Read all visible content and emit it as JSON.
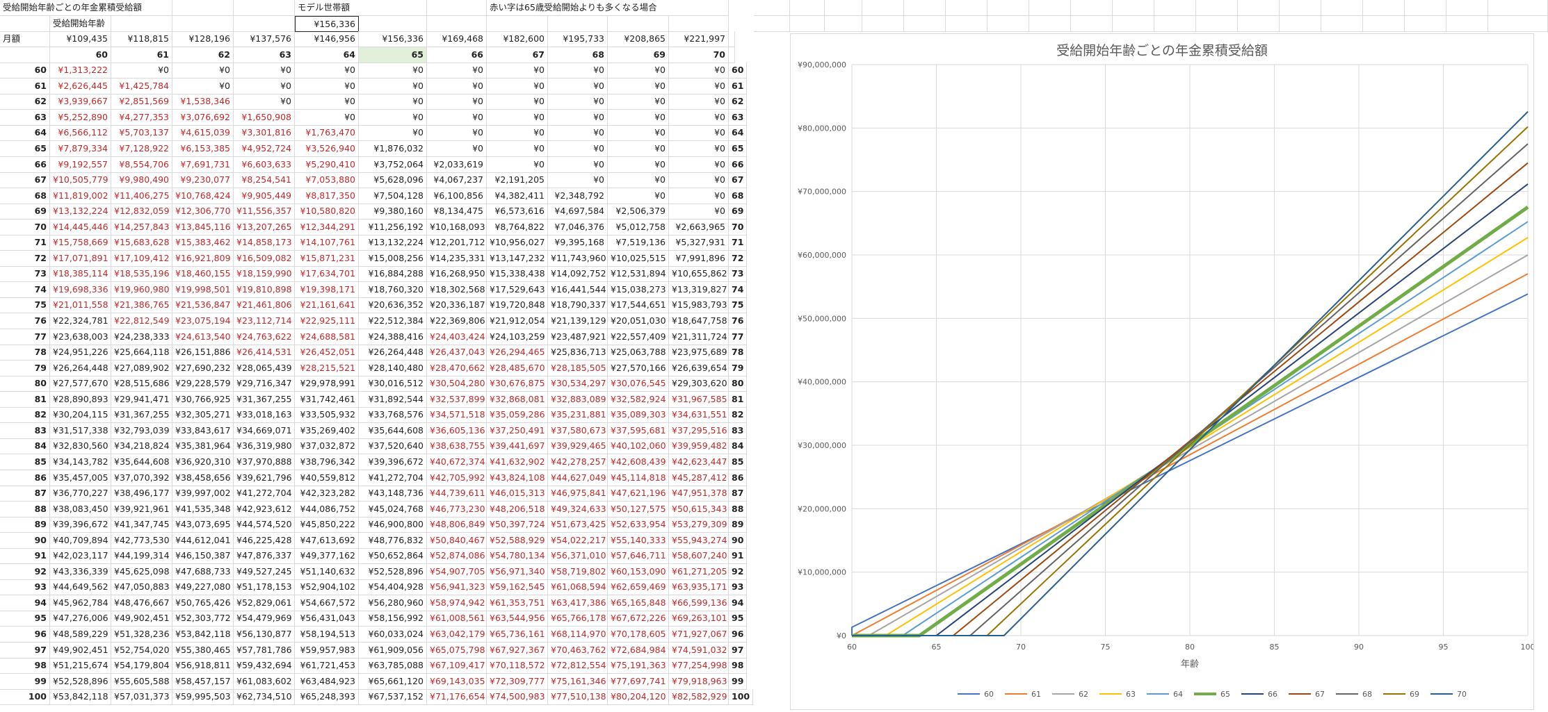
{
  "sheet": {
    "title": "受給開始年齢ごとの年金累積受給額",
    "model_label": "モデル世帯額",
    "red_note": "赤い字は65歳受給開始よりも多くなる場合",
    "start_label": "受給開始年齢",
    "model_value": "¥156,336",
    "monthly_label": "月額",
    "monthly": [
      "¥109,435",
      "¥118,815",
      "¥128,196",
      "¥137,576",
      "¥146,956",
      "¥156,336",
      "¥169,468",
      "¥182,600",
      "¥195,733",
      "¥208,865",
      "¥221,997"
    ],
    "start_ages": [
      "60",
      "61",
      "62",
      "63",
      "64",
      "65",
      "66",
      "67",
      "68",
      "69",
      "70"
    ],
    "rows": [
      {
        "age": "60",
        "cells": [
          "¥1,313,222",
          "¥0",
          "¥0",
          "¥0",
          "¥0",
          "¥0",
          "¥0",
          "¥0",
          "¥0",
          "¥0",
          "¥0"
        ]
      },
      {
        "age": "61",
        "cells": [
          "¥2,626,445",
          "¥1,425,784",
          "¥0",
          "¥0",
          "¥0",
          "¥0",
          "¥0",
          "¥0",
          "¥0",
          "¥0",
          "¥0"
        ]
      },
      {
        "age": "62",
        "cells": [
          "¥3,939,667",
          "¥2,851,569",
          "¥1,538,346",
          "¥0",
          "¥0",
          "¥0",
          "¥0",
          "¥0",
          "¥0",
          "¥0",
          "¥0"
        ]
      },
      {
        "age": "63",
        "cells": [
          "¥5,252,890",
          "¥4,277,353",
          "¥3,076,692",
          "¥1,650,908",
          "¥0",
          "¥0",
          "¥0",
          "¥0",
          "¥0",
          "¥0",
          "¥0"
        ]
      },
      {
        "age": "64",
        "cells": [
          "¥6,566,112",
          "¥5,703,137",
          "¥4,615,039",
          "¥3,301,816",
          "¥1,763,470",
          "¥0",
          "¥0",
          "¥0",
          "¥0",
          "¥0",
          "¥0"
        ]
      },
      {
        "age": "65",
        "cells": [
          "¥7,879,334",
          "¥7,128,922",
          "¥6,153,385",
          "¥4,952,724",
          "¥3,526,940",
          "¥1,876,032",
          "¥0",
          "¥0",
          "¥0",
          "¥0",
          "¥0"
        ]
      },
      {
        "age": "66",
        "cells": [
          "¥9,192,557",
          "¥8,554,706",
          "¥7,691,731",
          "¥6,603,633",
          "¥5,290,410",
          "¥3,752,064",
          "¥2,033,619",
          "¥0",
          "¥0",
          "¥0",
          "¥0"
        ]
      },
      {
        "age": "67",
        "cells": [
          "¥10,505,779",
          "¥9,980,490",
          "¥9,230,077",
          "¥8,254,541",
          "¥7,053,880",
          "¥5,628,096",
          "¥4,067,237",
          "¥2,191,205",
          "¥0",
          "¥0",
          "¥0"
        ]
      },
      {
        "age": "68",
        "cells": [
          "¥11,819,002",
          "¥11,406,275",
          "¥10,768,424",
          "¥9,905,449",
          "¥8,817,350",
          "¥7,504,128",
          "¥6,100,856",
          "¥4,382,411",
          "¥2,348,792",
          "¥0",
          "¥0"
        ]
      },
      {
        "age": "69",
        "cells": [
          "¥13,132,224",
          "¥12,832,059",
          "¥12,306,770",
          "¥11,556,357",
          "¥10,580,820",
          "¥9,380,160",
          "¥8,134,475",
          "¥6,573,616",
          "¥4,697,584",
          "¥2,506,379",
          "¥0"
        ]
      },
      {
        "age": "70",
        "cells": [
          "¥14,445,446",
          "¥14,257,843",
          "¥13,845,116",
          "¥13,207,265",
          "¥12,344,291",
          "¥11,256,192",
          "¥10,168,093",
          "¥8,764,822",
          "¥7,046,376",
          "¥5,012,758",
          "¥2,663,965"
        ]
      },
      {
        "age": "71",
        "cells": [
          "¥15,758,669",
          "¥15,683,628",
          "¥15,383,462",
          "¥14,858,173",
          "¥14,107,761",
          "¥13,132,224",
          "¥12,201,712",
          "¥10,956,027",
          "¥9,395,168",
          "¥7,519,136",
          "¥5,327,931"
        ]
      },
      {
        "age": "72",
        "cells": [
          "¥17,071,891",
          "¥17,109,412",
          "¥16,921,809",
          "¥16,509,082",
          "¥15,871,231",
          "¥15,008,256",
          "¥14,235,331",
          "¥13,147,232",
          "¥11,743,960",
          "¥10,025,515",
          "¥7,991,896"
        ]
      },
      {
        "age": "73",
        "cells": [
          "¥18,385,114",
          "¥18,535,196",
          "¥18,460,155",
          "¥18,159,990",
          "¥17,634,701",
          "¥16,884,288",
          "¥16,268,950",
          "¥15,338,438",
          "¥14,092,752",
          "¥12,531,894",
          "¥10,655,862"
        ]
      },
      {
        "age": "74",
        "cells": [
          "¥19,698,336",
          "¥19,960,980",
          "¥19,998,501",
          "¥19,810,898",
          "¥19,398,171",
          "¥18,760,320",
          "¥18,302,568",
          "¥17,529,643",
          "¥16,441,544",
          "¥15,038,273",
          "¥13,319,827"
        ]
      },
      {
        "age": "75",
        "cells": [
          "¥21,011,558",
          "¥21,386,765",
          "¥21,536,847",
          "¥21,461,806",
          "¥21,161,641",
          "¥20,636,352",
          "¥20,336,187",
          "¥19,720,848",
          "¥18,790,337",
          "¥17,544,651",
          "¥15,983,793"
        ]
      },
      {
        "age": "76",
        "cells": [
          "¥22,324,781",
          "¥22,812,549",
          "¥23,075,194",
          "¥23,112,714",
          "¥22,925,111",
          "¥22,512,384",
          "¥22,369,806",
          "¥21,912,054",
          "¥21,139,129",
          "¥20,051,030",
          "¥18,647,758"
        ]
      },
      {
        "age": "77",
        "cells": [
          "¥23,638,003",
          "¥24,238,333",
          "¥24,613,540",
          "¥24,763,622",
          "¥24,688,581",
          "¥24,388,416",
          "¥24,403,424",
          "¥24,103,259",
          "¥23,487,921",
          "¥22,557,409",
          "¥21,311,724"
        ]
      },
      {
        "age": "78",
        "cells": [
          "¥24,951,226",
          "¥25,664,118",
          "¥26,151,886",
          "¥26,414,531",
          "¥26,452,051",
          "¥26,264,448",
          "¥26,437,043",
          "¥26,294,465",
          "¥25,836,713",
          "¥25,063,788",
          "¥23,975,689"
        ]
      },
      {
        "age": "79",
        "cells": [
          "¥26,264,448",
          "¥27,089,902",
          "¥27,690,232",
          "¥28,065,439",
          "¥28,215,521",
          "¥28,140,480",
          "¥28,470,662",
          "¥28,485,670",
          "¥28,185,505",
          "¥27,570,166",
          "¥26,639,654"
        ]
      },
      {
        "age": "80",
        "cells": [
          "¥27,577,670",
          "¥28,515,686",
          "¥29,228,579",
          "¥29,716,347",
          "¥29,978,991",
          "¥30,016,512",
          "¥30,504,280",
          "¥30,676,875",
          "¥30,534,297",
          "¥30,076,545",
          "¥29,303,620"
        ]
      },
      {
        "age": "81",
        "cells": [
          "¥28,890,893",
          "¥29,941,471",
          "¥30,766,925",
          "¥31,367,255",
          "¥31,742,461",
          "¥31,892,544",
          "¥32,537,899",
          "¥32,868,081",
          "¥32,883,089",
          "¥32,582,924",
          "¥31,967,585"
        ]
      },
      {
        "age": "82",
        "cells": [
          "¥30,204,115",
          "¥31,367,255",
          "¥32,305,271",
          "¥33,018,163",
          "¥33,505,932",
          "¥33,768,576",
          "¥34,571,518",
          "¥35,059,286",
          "¥35,231,881",
          "¥35,089,303",
          "¥34,631,551"
        ]
      },
      {
        "age": "83",
        "cells": [
          "¥31,517,338",
          "¥32,793,039",
          "¥33,843,617",
          "¥34,669,071",
          "¥35,269,402",
          "¥35,644,608",
          "¥36,605,136",
          "¥37,250,491",
          "¥37,580,673",
          "¥37,595,681",
          "¥37,295,516"
        ]
      },
      {
        "age": "84",
        "cells": [
          "¥32,830,560",
          "¥34,218,824",
          "¥35,381,964",
          "¥36,319,980",
          "¥37,032,872",
          "¥37,520,640",
          "¥38,638,755",
          "¥39,441,697",
          "¥39,929,465",
          "¥40,102,060",
          "¥39,959,482"
        ]
      },
      {
        "age": "85",
        "cells": [
          "¥34,143,782",
          "¥35,644,608",
          "¥36,920,310",
          "¥37,970,888",
          "¥38,796,342",
          "¥39,396,672",
          "¥40,672,374",
          "¥41,632,902",
          "¥42,278,257",
          "¥42,608,439",
          "¥42,623,447"
        ]
      },
      {
        "age": "86",
        "cells": [
          "¥35,457,005",
          "¥37,070,392",
          "¥38,458,656",
          "¥39,621,796",
          "¥40,559,812",
          "¥41,272,704",
          "¥42,705,992",
          "¥43,824,108",
          "¥44,627,049",
          "¥45,114,818",
          "¥45,287,412"
        ]
      },
      {
        "age": "87",
        "cells": [
          "¥36,770,227",
          "¥38,496,177",
          "¥39,997,002",
          "¥41,272,704",
          "¥42,323,282",
          "¥43,148,736",
          "¥44,739,611",
          "¥46,015,313",
          "¥46,975,841",
          "¥47,621,196",
          "¥47,951,378"
        ]
      },
      {
        "age": "88",
        "cells": [
          "¥38,083,450",
          "¥39,921,961",
          "¥41,535,348",
          "¥42,923,612",
          "¥44,086,752",
          "¥45,024,768",
          "¥46,773,230",
          "¥48,206,518",
          "¥49,324,633",
          "¥50,127,575",
          "¥50,615,343"
        ]
      },
      {
        "age": "89",
        "cells": [
          "¥39,396,672",
          "¥41,347,745",
          "¥43,073,695",
          "¥44,574,520",
          "¥45,850,222",
          "¥46,900,800",
          "¥48,806,849",
          "¥50,397,724",
          "¥51,673,425",
          "¥52,633,954",
          "¥53,279,309"
        ]
      },
      {
        "age": "90",
        "cells": [
          "¥40,709,894",
          "¥42,773,530",
          "¥44,612,041",
          "¥46,225,428",
          "¥47,613,692",
          "¥48,776,832",
          "¥50,840,467",
          "¥52,588,929",
          "¥54,022,217",
          "¥55,140,333",
          "¥55,943,274"
        ]
      },
      {
        "age": "91",
        "cells": [
          "¥42,023,117",
          "¥44,199,314",
          "¥46,150,387",
          "¥47,876,337",
          "¥49,377,162",
          "¥50,652,864",
          "¥52,874,086",
          "¥54,780,134",
          "¥56,371,010",
          "¥57,646,711",
          "¥58,607,240"
        ]
      },
      {
        "age": "92",
        "cells": [
          "¥43,336,339",
          "¥45,625,098",
          "¥47,688,733",
          "¥49,527,245",
          "¥51,140,632",
          "¥52,528,896",
          "¥54,907,705",
          "¥56,971,340",
          "¥58,719,802",
          "¥60,153,090",
          "¥61,271,205"
        ]
      },
      {
        "age": "93",
        "cells": [
          "¥44,649,562",
          "¥47,050,883",
          "¥49,227,080",
          "¥51,178,153",
          "¥52,904,102",
          "¥54,404,928",
          "¥56,941,323",
          "¥59,162,545",
          "¥61,068,594",
          "¥62,659,469",
          "¥63,935,171"
        ]
      },
      {
        "age": "94",
        "cells": [
          "¥45,962,784",
          "¥48,476,667",
          "¥50,765,426",
          "¥52,829,061",
          "¥54,667,572",
          "¥56,280,960",
          "¥58,974,942",
          "¥61,353,751",
          "¥63,417,386",
          "¥65,165,848",
          "¥66,599,136"
        ]
      },
      {
        "age": "95",
        "cells": [
          "¥47,276,006",
          "¥49,902,451",
          "¥52,303,772",
          "¥54,479,969",
          "¥56,431,043",
          "¥58,156,992",
          "¥61,008,561",
          "¥63,544,956",
          "¥65,766,178",
          "¥67,672,226",
          "¥69,263,101"
        ]
      },
      {
        "age": "96",
        "cells": [
          "¥48,589,229",
          "¥51,328,236",
          "¥53,842,118",
          "¥56,130,877",
          "¥58,194,513",
          "¥60,033,024",
          "¥63,042,179",
          "¥65,736,161",
          "¥68,114,970",
          "¥70,178,605",
          "¥71,927,067"
        ]
      },
      {
        "age": "97",
        "cells": [
          "¥49,902,451",
          "¥52,754,020",
          "¥55,380,465",
          "¥57,781,786",
          "¥59,957,983",
          "¥61,909,056",
          "¥65,075,798",
          "¥67,927,367",
          "¥70,463,762",
          "¥72,684,984",
          "¥74,591,032"
        ]
      },
      {
        "age": "98",
        "cells": [
          "¥51,215,674",
          "¥54,179,804",
          "¥56,918,811",
          "¥59,432,694",
          "¥61,721,453",
          "¥63,785,088",
          "¥67,109,417",
          "¥70,118,572",
          "¥72,812,554",
          "¥75,191,363",
          "¥77,254,998"
        ]
      },
      {
        "age": "99",
        "cells": [
          "¥52,528,896",
          "¥55,605,588",
          "¥58,457,157",
          "¥61,083,602",
          "¥63,484,923",
          "¥65,661,120",
          "¥69,143,035",
          "¥72,309,777",
          "¥75,161,346",
          "¥77,697,741",
          "¥79,918,963"
        ]
      },
      {
        "age": "100",
        "cells": [
          "¥53,842,118",
          "¥57,031,373",
          "¥59,995,503",
          "¥62,734,510",
          "¥65,248,393",
          "¥67,537,152",
          "¥71,176,654",
          "¥74,500,983",
          "¥77,510,138",
          "¥80,204,120",
          "¥82,582,929"
        ]
      }
    ]
  },
  "colors": {
    "red": "#c0292b",
    "highlight": "#e2efda"
  },
  "chart_data": {
    "type": "line",
    "title": "受給開始年齢ごとの年金累積受給額",
    "xlabel": "年齢",
    "ylabel": "",
    "xlim": [
      60,
      100
    ],
    "ylim": [
      0,
      90000000
    ],
    "x_ticks": [
      "60",
      "65",
      "70",
      "75",
      "80",
      "85",
      "90",
      "95",
      "100"
    ],
    "y_ticks": [
      "¥0",
      "¥10,000,000",
      "¥20,000,000",
      "¥30,000,000",
      "¥40,000,000",
      "¥50,000,000",
      "¥60,000,000",
      "¥70,000,000",
      "¥80,000,000",
      "¥90,000,000"
    ],
    "grid": true,
    "legend_position": "bottom",
    "series": [
      {
        "name": "60",
        "color": "#4472c4",
        "width": 2,
        "start": 60,
        "monthly": 109435
      },
      {
        "name": "61",
        "color": "#ed7d31",
        "width": 2,
        "start": 61,
        "monthly": 118815
      },
      {
        "name": "62",
        "color": "#a5a5a5",
        "width": 2,
        "start": 62,
        "monthly": 128196
      },
      {
        "name": "63",
        "color": "#ffc000",
        "width": 2,
        "start": 63,
        "monthly": 137576
      },
      {
        "name": "64",
        "color": "#5b9bd5",
        "width": 2,
        "start": 64,
        "monthly": 146956
      },
      {
        "name": "65",
        "color": "#70ad47",
        "width": 5,
        "start": 65,
        "monthly": 156336
      },
      {
        "name": "66",
        "color": "#264478",
        "width": 2,
        "start": 66,
        "monthly": 169468
      },
      {
        "name": "67",
        "color": "#9e480e",
        "width": 2,
        "start": 67,
        "monthly": 182600
      },
      {
        "name": "68",
        "color": "#636363",
        "width": 2,
        "start": 68,
        "monthly": 195733
      },
      {
        "name": "69",
        "color": "#997300",
        "width": 2,
        "start": 69,
        "monthly": 208865
      },
      {
        "name": "70",
        "color": "#255e91",
        "width": 2,
        "start": 70,
        "monthly": 221997
      }
    ],
    "points_note": "values per series derived from the sheet table above"
  }
}
